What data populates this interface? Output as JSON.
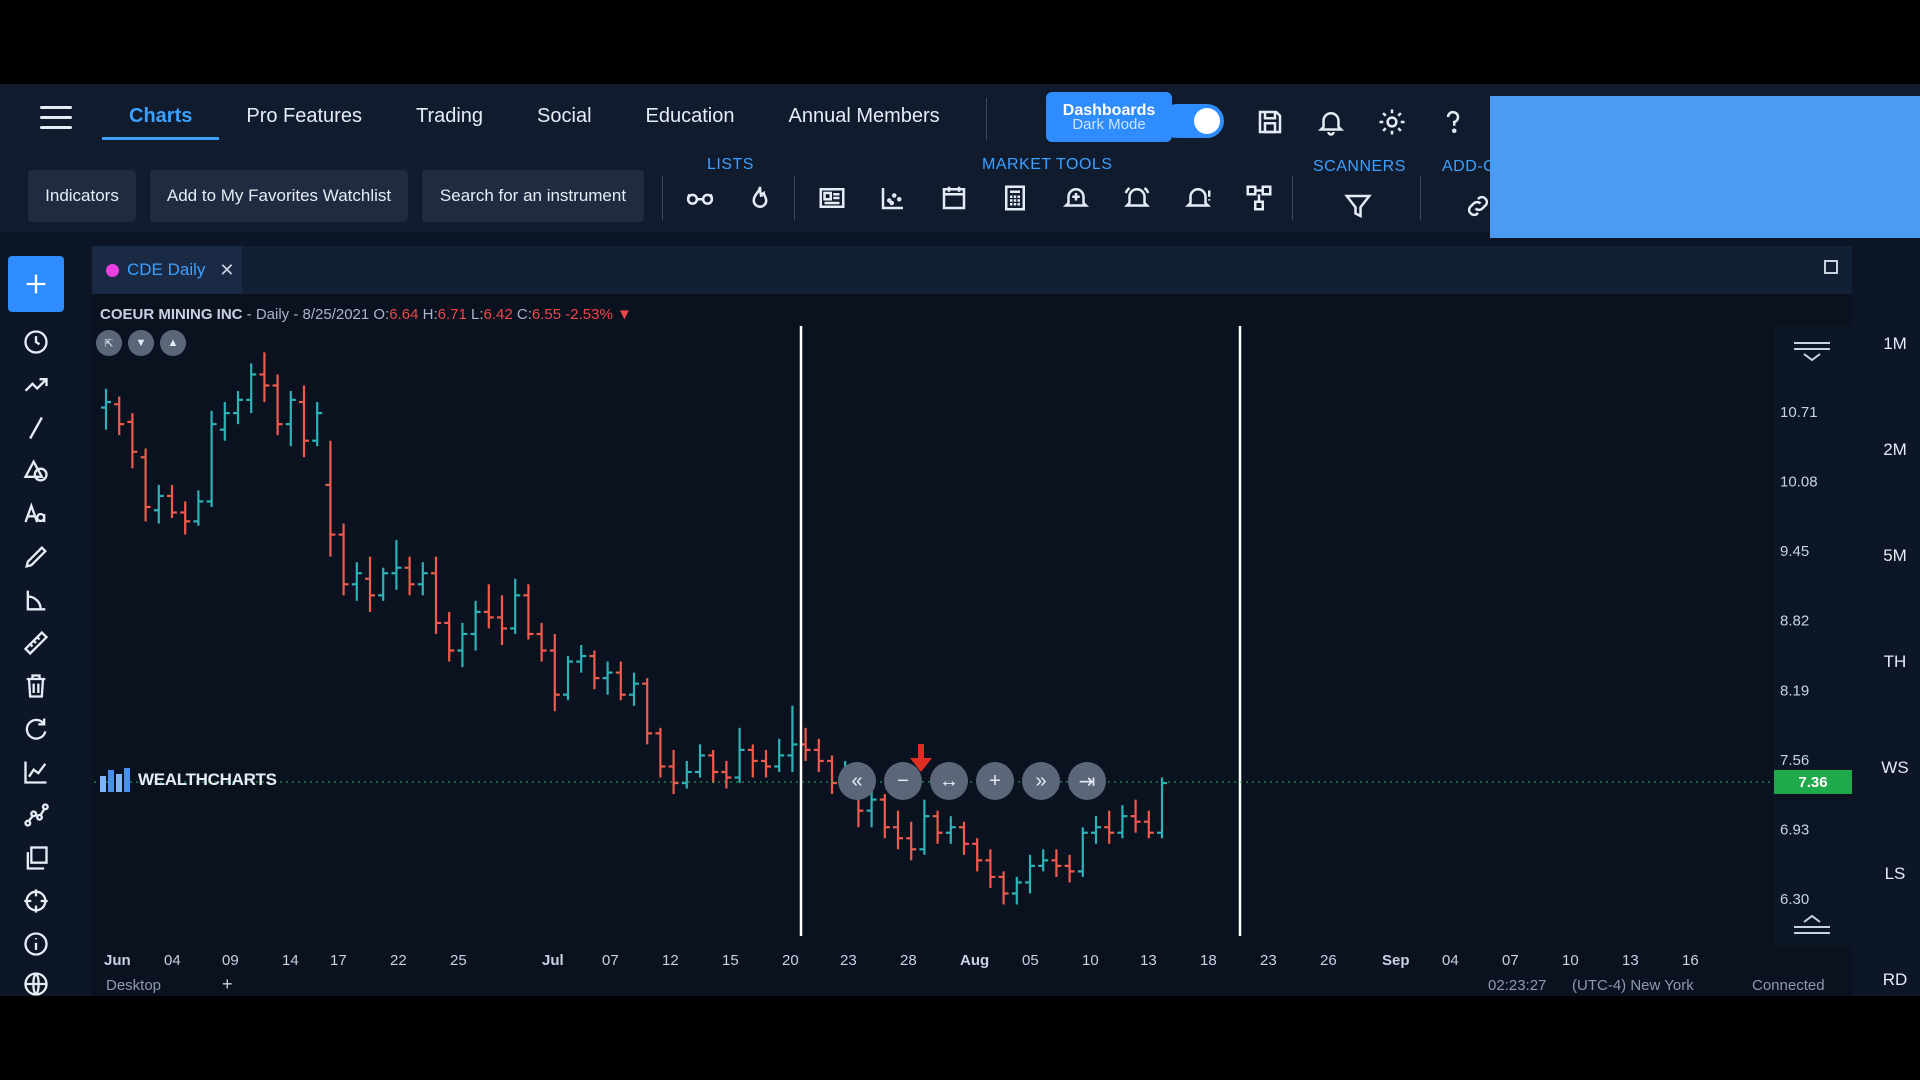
{
  "nav": {
    "tabs": [
      "Charts",
      "Pro Features",
      "Trading",
      "Social",
      "Education",
      "Annual Members"
    ],
    "dashboards_label": "Dashboards",
    "dark_mode_label": "Dark Mode"
  },
  "toolbar": {
    "indicators": "Indicators",
    "favorites": "Add to My Favorites Watchlist",
    "search": "Search for an instrument",
    "lists_label": "LISTS",
    "market_tools_label": "MARKET TOOLS",
    "scanners_label": "SCANNERS",
    "addons_label": "ADD-O"
  },
  "chart_tab": {
    "label": "CDE Daily",
    "close": "✕"
  },
  "info": {
    "symbol": "COEUR MINING INC",
    "meta": " - Daily - 8/25/2021 ",
    "o_label": "O:",
    "o": "6.64",
    "h_label": " H:",
    "h": "6.71",
    "l_label": " L:",
    "l": "6.42",
    "c_label": " C:",
    "c": "6.55",
    "chg": " -2.53% ▼"
  },
  "logo": "WEALTHCHARTS",
  "right_rail": [
    "1M",
    "2M",
    "5M",
    "TH",
    "WS",
    "LS",
    "RD"
  ],
  "bottom": {
    "left": "Desktop",
    "time": "02:23:27",
    "tz": "(UTC-4) New York",
    "status": "Connected"
  },
  "colors": {
    "up": "#2bb3b8",
    "down": "#ef5b4c",
    "price_badge": "#1ea94b",
    "accent": "#2f8cff"
  },
  "chart_data": {
    "type": "ohlc",
    "symbol": "CDE",
    "interval": "Daily",
    "y_ticks": [
      "10.71",
      "10.08",
      "9.45",
      "8.82",
      "8.19",
      "7.56",
      "6.93",
      "6.30"
    ],
    "current_price": "7.36",
    "x_ticks": [
      "Jun",
      "04",
      "09",
      "14",
      "17",
      "22",
      "25",
      "Jul",
      "07",
      "12",
      "15",
      "20",
      "23",
      "28",
      "Aug",
      "05",
      "10",
      "13",
      "18",
      "23",
      "26",
      "Sep",
      "04",
      "07",
      "10",
      "13",
      "16"
    ],
    "bars": [
      [
        10.75,
        10.92,
        10.55,
        10.8
      ],
      [
        10.78,
        10.85,
        10.5,
        10.6
      ],
      [
        10.62,
        10.7,
        10.2,
        10.35
      ],
      [
        10.3,
        10.38,
        9.72,
        9.85
      ],
      [
        9.82,
        10.05,
        9.7,
        9.95
      ],
      [
        9.95,
        10.05,
        9.75,
        9.8
      ],
      [
        9.8,
        9.9,
        9.6,
        9.72
      ],
      [
        9.72,
        10.0,
        9.68,
        9.9
      ],
      [
        9.9,
        10.72,
        9.85,
        10.6
      ],
      [
        10.55,
        10.8,
        10.45,
        10.7
      ],
      [
        10.7,
        10.9,
        10.6,
        10.82
      ],
      [
        10.82,
        11.15,
        10.7,
        11.05
      ],
      [
        11.05,
        11.25,
        10.8,
        10.95
      ],
      [
        10.95,
        11.05,
        10.5,
        10.6
      ],
      [
        10.6,
        10.9,
        10.4,
        10.82
      ],
      [
        10.8,
        10.95,
        10.3,
        10.45
      ],
      [
        10.45,
        10.8,
        10.4,
        10.7
      ],
      [
        10.05,
        10.45,
        9.4,
        9.6
      ],
      [
        9.6,
        9.7,
        9.05,
        9.15
      ],
      [
        9.15,
        9.35,
        9.0,
        9.25
      ],
      [
        9.2,
        9.4,
        8.9,
        9.05
      ],
      [
        9.05,
        9.3,
        9.0,
        9.25
      ],
      [
        9.25,
        9.55,
        9.1,
        9.3
      ],
      [
        9.3,
        9.4,
        9.05,
        9.15
      ],
      [
        9.15,
        9.35,
        9.05,
        9.25
      ],
      [
        9.25,
        9.4,
        8.7,
        8.8
      ],
      [
        8.8,
        8.9,
        8.45,
        8.55
      ],
      [
        8.55,
        8.8,
        8.4,
        8.7
      ],
      [
        8.7,
        9.0,
        8.55,
        8.9
      ],
      [
        8.9,
        9.15,
        8.75,
        8.85
      ],
      [
        8.85,
        9.05,
        8.6,
        8.75
      ],
      [
        8.75,
        9.2,
        8.7,
        9.05
      ],
      [
        9.05,
        9.15,
        8.65,
        8.7
      ],
      [
        8.7,
        8.8,
        8.45,
        8.55
      ],
      [
        8.55,
        8.7,
        8.0,
        8.15
      ],
      [
        8.15,
        8.5,
        8.1,
        8.45
      ],
      [
        8.45,
        8.6,
        8.35,
        8.5
      ],
      [
        8.5,
        8.55,
        8.2,
        8.3
      ],
      [
        8.3,
        8.45,
        8.15,
        8.35
      ],
      [
        8.35,
        8.45,
        8.1,
        8.15
      ],
      [
        8.15,
        8.35,
        8.05,
        8.25
      ],
      [
        8.25,
        8.3,
        7.7,
        7.8
      ],
      [
        7.8,
        7.85,
        7.4,
        7.5
      ],
      [
        7.5,
        7.65,
        7.25,
        7.35
      ],
      [
        7.35,
        7.55,
        7.3,
        7.45
      ],
      [
        7.45,
        7.7,
        7.4,
        7.6
      ],
      [
        7.6,
        7.65,
        7.35,
        7.45
      ],
      [
        7.45,
        7.55,
        7.3,
        7.4
      ],
      [
        7.4,
        7.85,
        7.35,
        7.65
      ],
      [
        7.65,
        7.7,
        7.4,
        7.55
      ],
      [
        7.55,
        7.65,
        7.4,
        7.5
      ],
      [
        7.5,
        7.75,
        7.45,
        7.6
      ],
      [
        7.6,
        8.05,
        7.45,
        7.7
      ],
      [
        7.7,
        7.85,
        7.55,
        7.65
      ],
      [
        7.65,
        7.75,
        7.45,
        7.55
      ],
      [
        7.55,
        7.6,
        7.25,
        7.35
      ],
      [
        7.35,
        7.55,
        7.25,
        7.4
      ],
      [
        7.4,
        7.5,
        6.95,
        7.1
      ],
      [
        7.1,
        7.3,
        6.95,
        7.2
      ],
      [
        7.2,
        7.25,
        6.85,
        6.95
      ],
      [
        6.95,
        7.1,
        6.75,
        6.85
      ],
      [
        6.85,
        7.0,
        6.65,
        6.75
      ],
      [
        6.75,
        7.2,
        6.7,
        7.05
      ],
      [
        7.05,
        7.1,
        6.8,
        6.9
      ],
      [
        6.9,
        7.05,
        6.8,
        6.95
      ],
      [
        6.95,
        7.0,
        6.7,
        6.8
      ],
      [
        6.8,
        6.85,
        6.55,
        6.65
      ],
      [
        6.65,
        6.75,
        6.4,
        6.5
      ],
      [
        6.5,
        6.55,
        6.25,
        6.35
      ],
      [
        6.35,
        6.5,
        6.25,
        6.45
      ],
      [
        6.45,
        6.7,
        6.35,
        6.6
      ],
      [
        6.6,
        6.75,
        6.55,
        6.65
      ],
      [
        6.65,
        6.75,
        6.5,
        6.6
      ],
      [
        6.6,
        6.7,
        6.45,
        6.55
      ],
      [
        6.55,
        6.95,
        6.5,
        6.9
      ],
      [
        6.9,
        7.05,
        6.8,
        6.95
      ],
      [
        6.95,
        7.1,
        6.8,
        6.9
      ],
      [
        6.9,
        7.15,
        6.85,
        7.05
      ],
      [
        7.05,
        7.2,
        6.9,
        7.0
      ],
      [
        7.0,
        7.1,
        6.85,
        6.9
      ],
      [
        6.9,
        7.4,
        6.85,
        7.35
      ]
    ],
    "vertical_markers": [
      "23 Jul",
      "23 Aug"
    ],
    "annotation": "down-arrow"
  }
}
